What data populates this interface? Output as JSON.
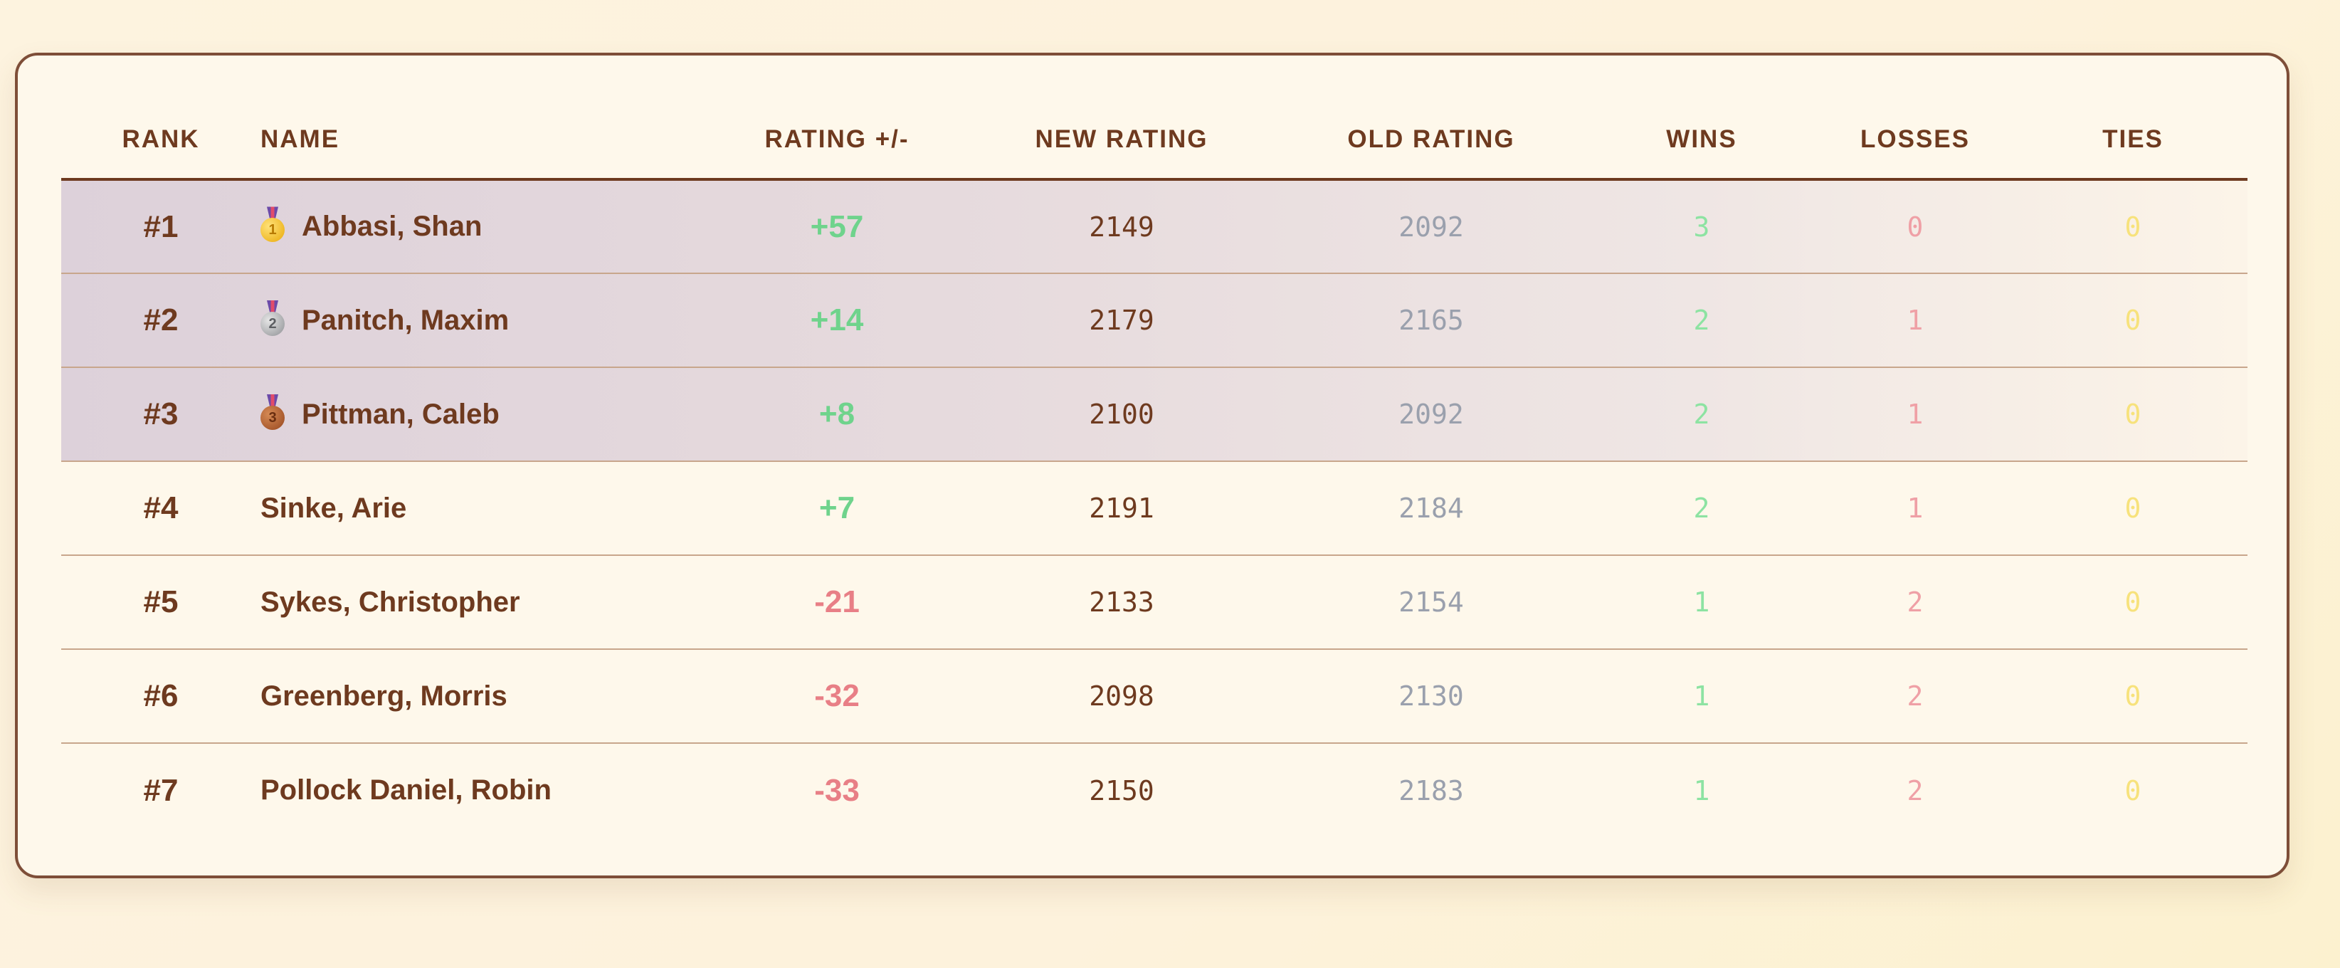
{
  "table": {
    "headers": {
      "rank": "RANK",
      "name": "NAME",
      "rating_delta": "RATING +/-",
      "new_rating": "NEW RATING",
      "old_rating": "OLD RATING",
      "wins": "WINS",
      "losses": "LOSSES",
      "ties": "TIES"
    },
    "rows": [
      {
        "rank": "#1",
        "medal": "gold-medal-icon",
        "medal_label": "1",
        "name": "Abbasi, Shan",
        "delta": "+57",
        "new_rating": "2149",
        "old_rating": "2092",
        "wins": "3",
        "losses": "0",
        "ties": "0"
      },
      {
        "rank": "#2",
        "medal": "silver-medal-icon",
        "medal_label": "2",
        "name": "Panitch, Maxim",
        "delta": "+14",
        "new_rating": "2179",
        "old_rating": "2165",
        "wins": "2",
        "losses": "1",
        "ties": "0"
      },
      {
        "rank": "#3",
        "medal": "bronze-medal-icon",
        "medal_label": "3",
        "name": "Pittman, Caleb",
        "delta": "+8",
        "new_rating": "2100",
        "old_rating": "2092",
        "wins": "2",
        "losses": "1",
        "ties": "0"
      },
      {
        "rank": "#4",
        "medal": null,
        "name": "Sinke, Arie",
        "delta": "+7",
        "new_rating": "2191",
        "old_rating": "2184",
        "wins": "2",
        "losses": "1",
        "ties": "0"
      },
      {
        "rank": "#5",
        "medal": null,
        "name": "Sykes, Christopher",
        "delta": "-21",
        "new_rating": "2133",
        "old_rating": "2154",
        "wins": "1",
        "losses": "2",
        "ties": "0"
      },
      {
        "rank": "#6",
        "medal": null,
        "name": "Greenberg, Morris",
        "delta": "-32",
        "new_rating": "2098",
        "old_rating": "2130",
        "wins": "1",
        "losses": "2",
        "ties": "0"
      },
      {
        "rank": "#7",
        "medal": null,
        "name": "Pollock Daniel, Robin",
        "delta": "-33",
        "new_rating": "2150",
        "old_rating": "2183",
        "wins": "1",
        "losses": "2",
        "ties": "0"
      }
    ]
  },
  "colors": {
    "text_brown": "#6e3a1f",
    "positive": "#6fd38c",
    "negative": "#e87f86",
    "old_rating": "#9aa0ad",
    "wins": "#8de3a2",
    "losses": "#efa0a6",
    "ties": "#f7e27c",
    "card_border": "#7e4e38",
    "card_bg": "#fef8eb"
  }
}
